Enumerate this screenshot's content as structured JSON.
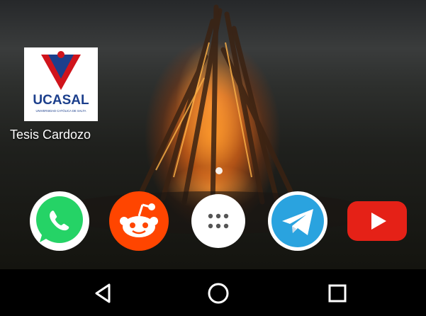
{
  "home_screen": {
    "shortcut": {
      "label": "Tesis Cardozo",
      "icon": "ucasal-logo-icon",
      "logo_text": "UCASAL",
      "logo_subtext": "UNIVERSIDAD CATÓLICA DE SALTA"
    },
    "page_indicator": {
      "pages": 1,
      "current": 1
    }
  },
  "dock": {
    "apps": [
      {
        "name": "WhatsApp",
        "icon": "whatsapp-icon",
        "color": "#25d366"
      },
      {
        "name": "Reddit",
        "icon": "reddit-icon",
        "color": "#ff4500"
      },
      {
        "name": "App drawer",
        "icon": "app-drawer-icon",
        "color": "#ffffff"
      },
      {
        "name": "Telegram",
        "icon": "telegram-icon",
        "color": "#2aa3df"
      },
      {
        "name": "YouTube",
        "icon": "youtube-icon",
        "color": "#e52117"
      }
    ]
  },
  "navigation_bar": {
    "buttons": [
      {
        "name": "Back",
        "icon": "back-triangle-icon"
      },
      {
        "name": "Home",
        "icon": "home-circle-icon"
      },
      {
        "name": "Recents",
        "icon": "recents-square-icon"
      }
    ]
  },
  "colors": {
    "ucasal_red": "#d0141c",
    "ucasal_blue": "#1c3f8c",
    "nav_bar": "#000000"
  }
}
